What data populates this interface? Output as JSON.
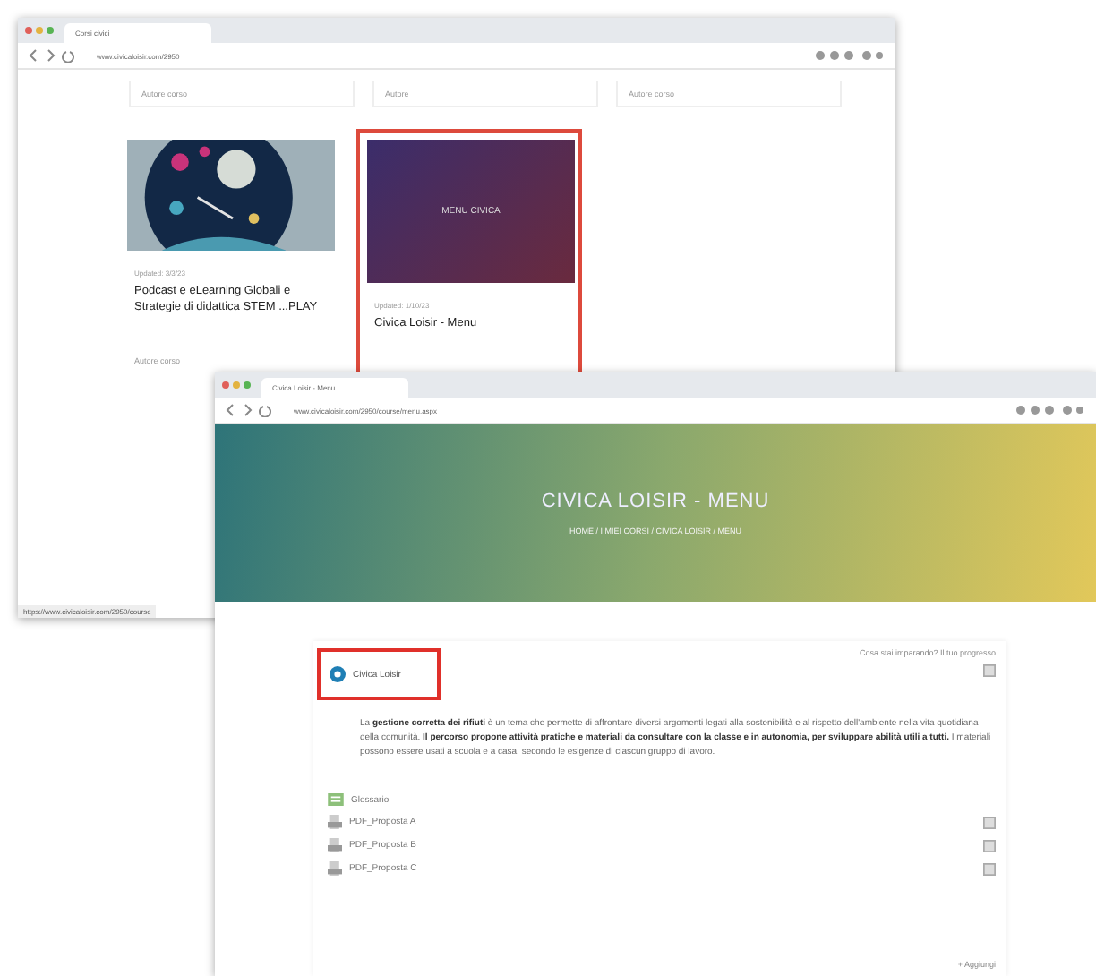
{
  "back_window": {
    "tab_title": "Corsi civici",
    "url": "www.civicaloisir.com/2950",
    "top_cards": [
      {
        "author": "Autore corso"
      },
      {
        "author": "Autore"
      },
      {
        "author": "Autore corso"
      }
    ],
    "cards": [
      {
        "kind": "picture",
        "date": "Updated: 3/3/23",
        "title": "Podcast e eLearning Globali e Strategie di didattica STEM ...PLAY",
        "author": "Autore corso",
        "highlighted": false
      },
      {
        "kind": "cover",
        "cover_text": "MENU CIVICA",
        "date": "Updated: 1/10/23",
        "title": "Civica Loisir - Menu",
        "highlighted": true
      }
    ],
    "status_url": "https://www.civicaloisir.com/2950/course"
  },
  "front_window": {
    "tab_title": "Civica Loisir - Menu",
    "url": "www.civicaloisir.com/2950/course/menu.aspx",
    "hero": {
      "title": "CIVICA LOISIR - MENU",
      "breadcrumb": "HOME / I MIEI CORSI / CIVICA LOISIR / MENU"
    },
    "panel": {
      "progress_link": "Cosa stai imparando? Il tuo progresso",
      "module": {
        "title": "Civica Loisir",
        "highlighted": true
      },
      "paragraph": "La **gestione corretta dei rifiuti** è un tema che permette di affrontare diversi argomenti legati alla sostenibilità e al rispetto dell'ambiente nella vita quotidiana della comunità. **Il percorso propone attività pratiche e materiali da consultare con la classe e in autonomia, per sviluppare abilità utili a tutti.** I materiali possono essere usati a scuola e a casa, secondo le esigenze di ciascun gruppo di lavoro.",
      "glossary": "Glossario",
      "files": [
        {
          "name": "PDF_Proposta A"
        },
        {
          "name": "PDF_Proposta B"
        },
        {
          "name": "PDF_Proposta C"
        }
      ],
      "add_link": "+ Aggiungi"
    }
  }
}
